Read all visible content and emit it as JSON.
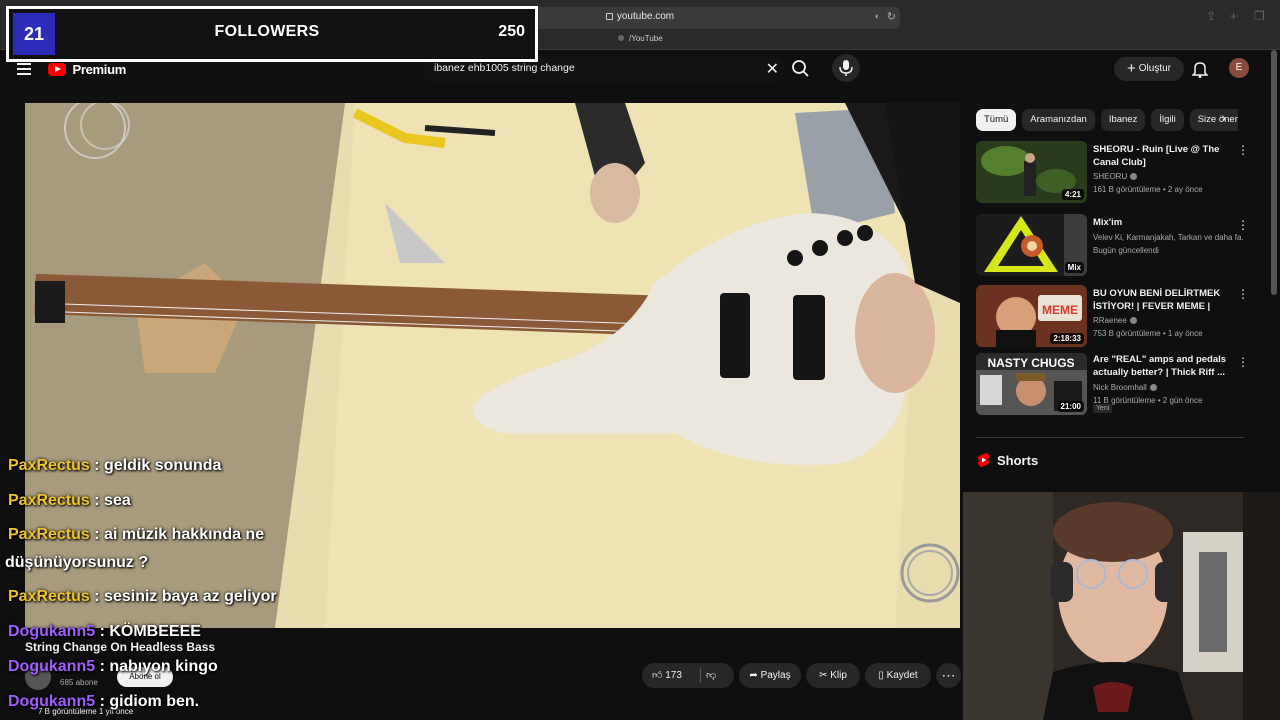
{
  "browser": {
    "url": "youtube.com",
    "tab_label": "/YouTube"
  },
  "followers_overlay": {
    "count": "21",
    "title": "FOLLOWERS",
    "goal": "250"
  },
  "header": {
    "logo_text": "Premium",
    "search_value": "ibanez ehb1005 string change",
    "create_label": "Oluştur",
    "avatar_letter": "E"
  },
  "chat": [
    {
      "user": "PaxRectus",
      "message": "geldik sonunda"
    },
    {
      "user": "PaxRectus",
      "message": "sea"
    },
    {
      "user": "PaxRectus",
      "message": "ai müzik hakkında ne"
    },
    {
      "user": "",
      "message": "düşünüyorsunuz ?"
    },
    {
      "user": "PaxRectus",
      "message": "sesiniz baya az geliyor"
    },
    {
      "user": "Dogukann5",
      "message": "KÖMBEEEE"
    },
    {
      "user": "Dogukann5",
      "message": "nabıyon kingo"
    },
    {
      "user": "Dogukann5",
      "message": "gidiom ben."
    }
  ],
  "video": {
    "title": "String Change On Headless Bass",
    "channel_subs": "685 abone",
    "subscribe_label": "Abone ol",
    "view_meta": "7 B görüntüleme  1 yıl önce",
    "like_count": "173",
    "share_label": "Paylaş",
    "clip_label": "Klip",
    "save_label": "Kaydet",
    "more_label": "⋯"
  },
  "chips": [
    "Tümü",
    "Aramanızdan",
    "Ibanez",
    "İlgili",
    "Size önerilenler"
  ],
  "recommendations": [
    {
      "title": "SHEORU - Ruin [Live @ The Canal Club]",
      "channel": "SHEORU",
      "verified": true,
      "meta": "161 B görüntüleme • 2 ay önce",
      "duration": "4:21",
      "badge": ""
    },
    {
      "title": "Mix'im",
      "channel": "Velev Ki, Karmanjakah, Tarkan ve daha fa...",
      "verified": false,
      "meta": "Bugün güncellendi",
      "duration": "Mix",
      "badge": ""
    },
    {
      "title": "BU OYUN BENİ DELİRTMEK İSTİYOR! | FEVER MEME |",
      "channel": "RRaenee",
      "verified": true,
      "meta": "753 B görüntüleme • 1 ay önce",
      "duration": "2:18:33",
      "badge": ""
    },
    {
      "title": "Are \"REAL\" amps and pedals actually better? | Thick Riff ...",
      "channel": "Nick Broomhall",
      "verified": true,
      "meta": "11 B görüntüleme • 2 gün önce",
      "duration": "21:00",
      "badge": "Yeni"
    }
  ],
  "shorts": {
    "title": "Shorts"
  },
  "thumbnail_text": {
    "nasty_chugs": "NASTY CHUGS",
    "meme": "MEME"
  },
  "colors": {
    "youtube_red": "#ff0000",
    "follower_blue": "#2c2cb8",
    "chat_user_yellow": "#f0c22c",
    "chat_user_purple": "#a05cff"
  }
}
